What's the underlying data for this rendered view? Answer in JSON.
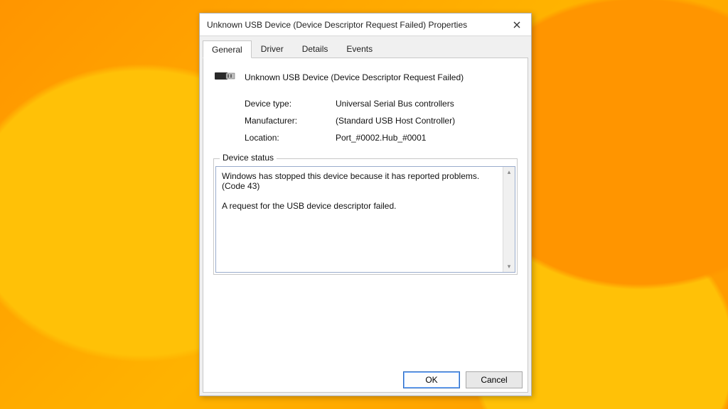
{
  "window": {
    "title": "Unknown USB Device (Device Descriptor Request Failed) Properties"
  },
  "tabs": {
    "general": "General",
    "driver": "Driver",
    "details": "Details",
    "events": "Events"
  },
  "device": {
    "name": "Unknown USB Device (Device Descriptor Request Failed)",
    "type_label": "Device type:",
    "type_value": "Universal Serial Bus controllers",
    "manufacturer_label": "Manufacturer:",
    "manufacturer_value": "(Standard USB Host Controller)",
    "location_label": "Location:",
    "location_value": "Port_#0002.Hub_#0001"
  },
  "status": {
    "legend": "Device status",
    "text": "Windows has stopped this device because it has reported problems. (Code 43)\n\nA request for the USB device descriptor failed."
  },
  "buttons": {
    "ok": "OK",
    "cancel": "Cancel"
  }
}
